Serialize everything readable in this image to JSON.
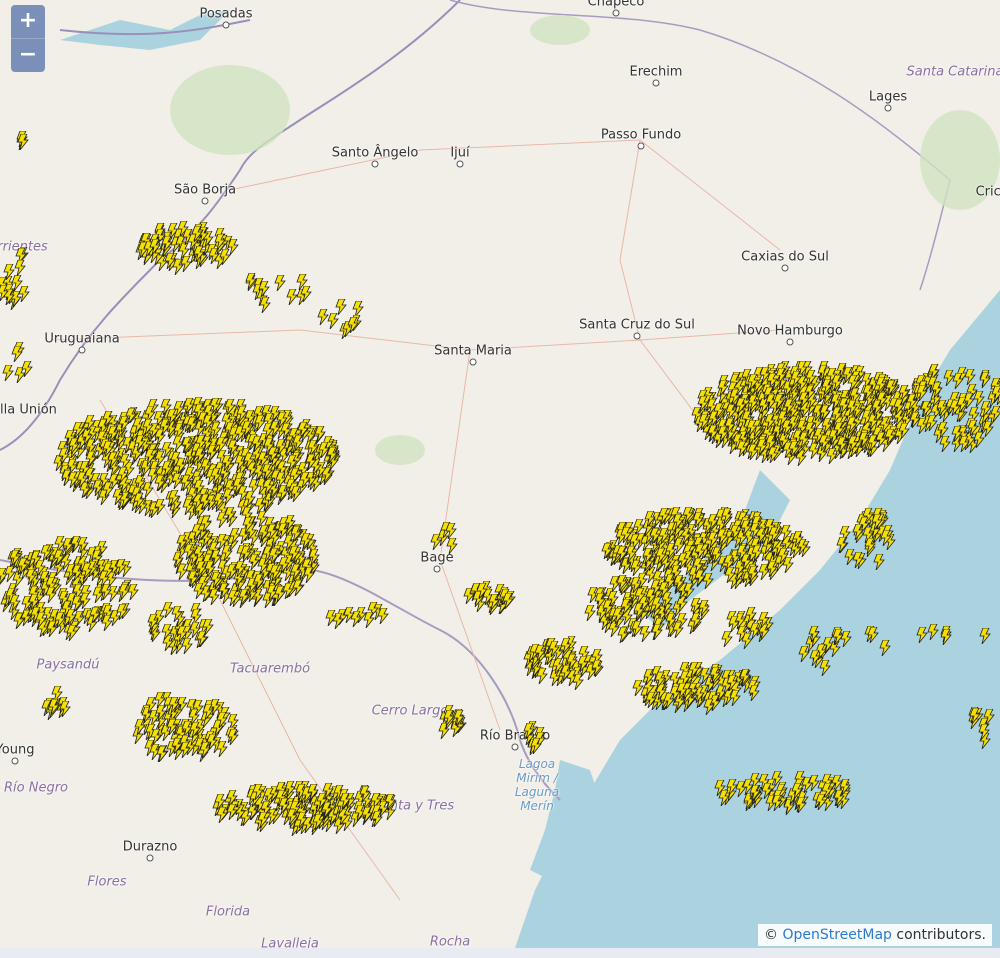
{
  "map": {
    "controls": {
      "zoom_in": "+",
      "zoom_out": "−"
    },
    "cities": [
      "Posadas",
      "Chapecó",
      "Erechim",
      "Lages",
      "Passo Fundo",
      "Santo Ângelo",
      "Ijuí",
      "São Borja",
      "Caxias do Sul",
      "Uruguaiana",
      "Santa Maria",
      "Santa Cruz do Sul",
      "Novo Hamburgo",
      "Bella Unión",
      "Bagé",
      "Tacuarembó",
      "Río Branco",
      "Young",
      "Durazno",
      "Cricí"
    ],
    "regions": [
      "Santa Catarina",
      "Corrientes",
      "Paysandú",
      "Tacuarembó",
      "Cerro Largo",
      "Río Negro",
      "Treinta y Tres",
      "Flores",
      "Florida",
      "Lavalleja",
      "Rocha"
    ],
    "water": [
      "Lagoa Mirim / Laguna Merín"
    ],
    "marker_icon": "lightning-bolt-icon",
    "marker_color": "#f5e000"
  },
  "attribution": {
    "symbol": "©",
    "link": "OpenStreetMap",
    "suffix": " contributors."
  }
}
